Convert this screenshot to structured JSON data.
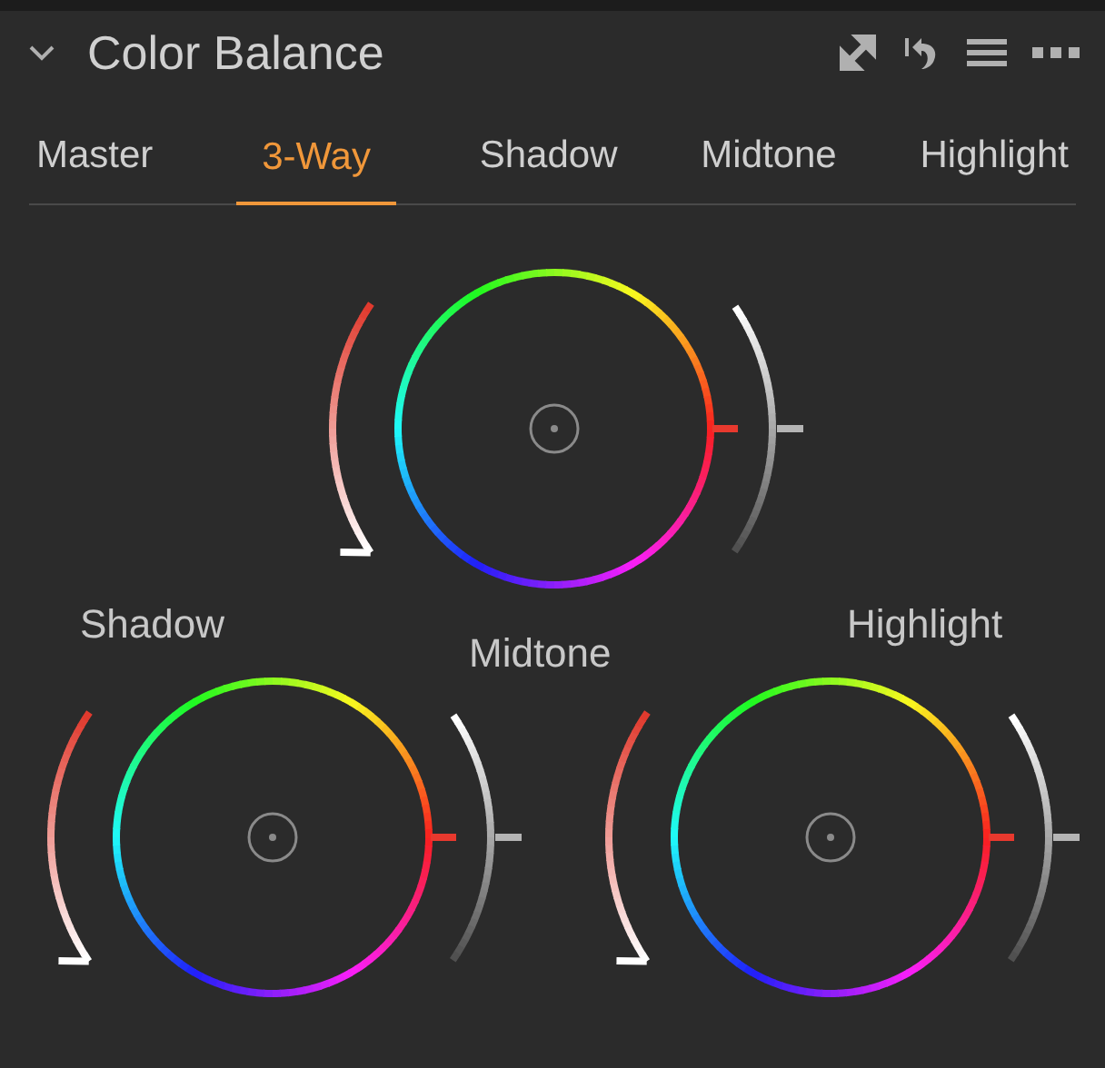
{
  "panel": {
    "title": "Color Balance",
    "expanded": true
  },
  "tabs": [
    {
      "label": "Master",
      "selected": false
    },
    {
      "label": "3-Way",
      "selected": true
    },
    {
      "label": "Shadow",
      "selected": false
    },
    {
      "label": "Midtone",
      "selected": false
    },
    {
      "label": "Highlight",
      "selected": false
    }
  ],
  "wheels": [
    {
      "label": "Midtone",
      "left_slider": {
        "level": 0
      },
      "right_slider": {
        "level": 0.5
      }
    },
    {
      "label": "Shadow",
      "left_slider": {
        "level": 0
      },
      "right_slider": {
        "level": 0.5
      }
    },
    {
      "label": "Highlight",
      "left_slider": {
        "level": 0
      },
      "right_slider": {
        "level": 0.5
      }
    }
  ]
}
